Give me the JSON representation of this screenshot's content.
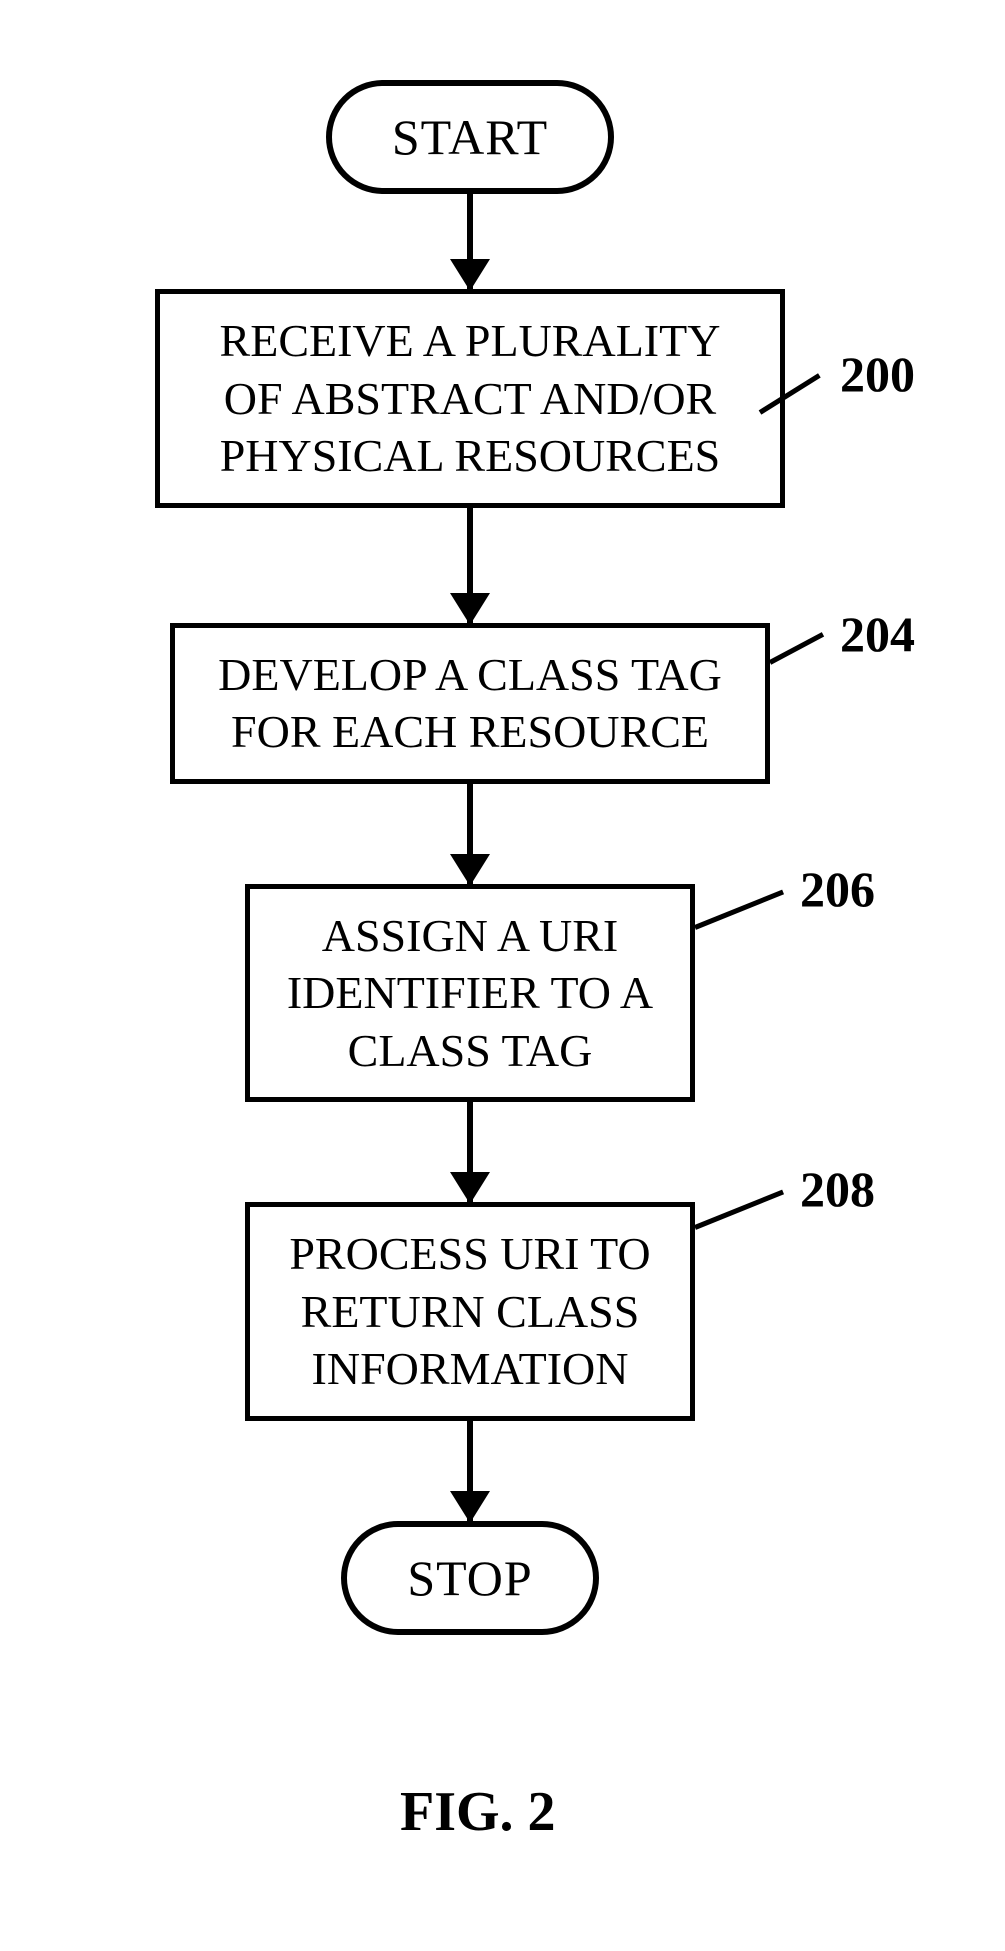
{
  "flowchart": {
    "start": "START",
    "stop": "STOP",
    "steps": [
      {
        "text": "RECEIVE A PLURALITY OF ABSTRACT AND/OR PHYSICAL RESOURCES",
        "ref": "200"
      },
      {
        "text": "DEVELOP A CLASS TAG FOR EACH RESOURCE",
        "ref": "204"
      },
      {
        "text": "ASSIGN A URI IDENTIFIER TO A CLASS TAG",
        "ref": "206"
      },
      {
        "text": "PROCESS URI TO RETURN CLASS INFORMATION",
        "ref": "208"
      }
    ]
  },
  "figure_caption": "FIG. 2"
}
